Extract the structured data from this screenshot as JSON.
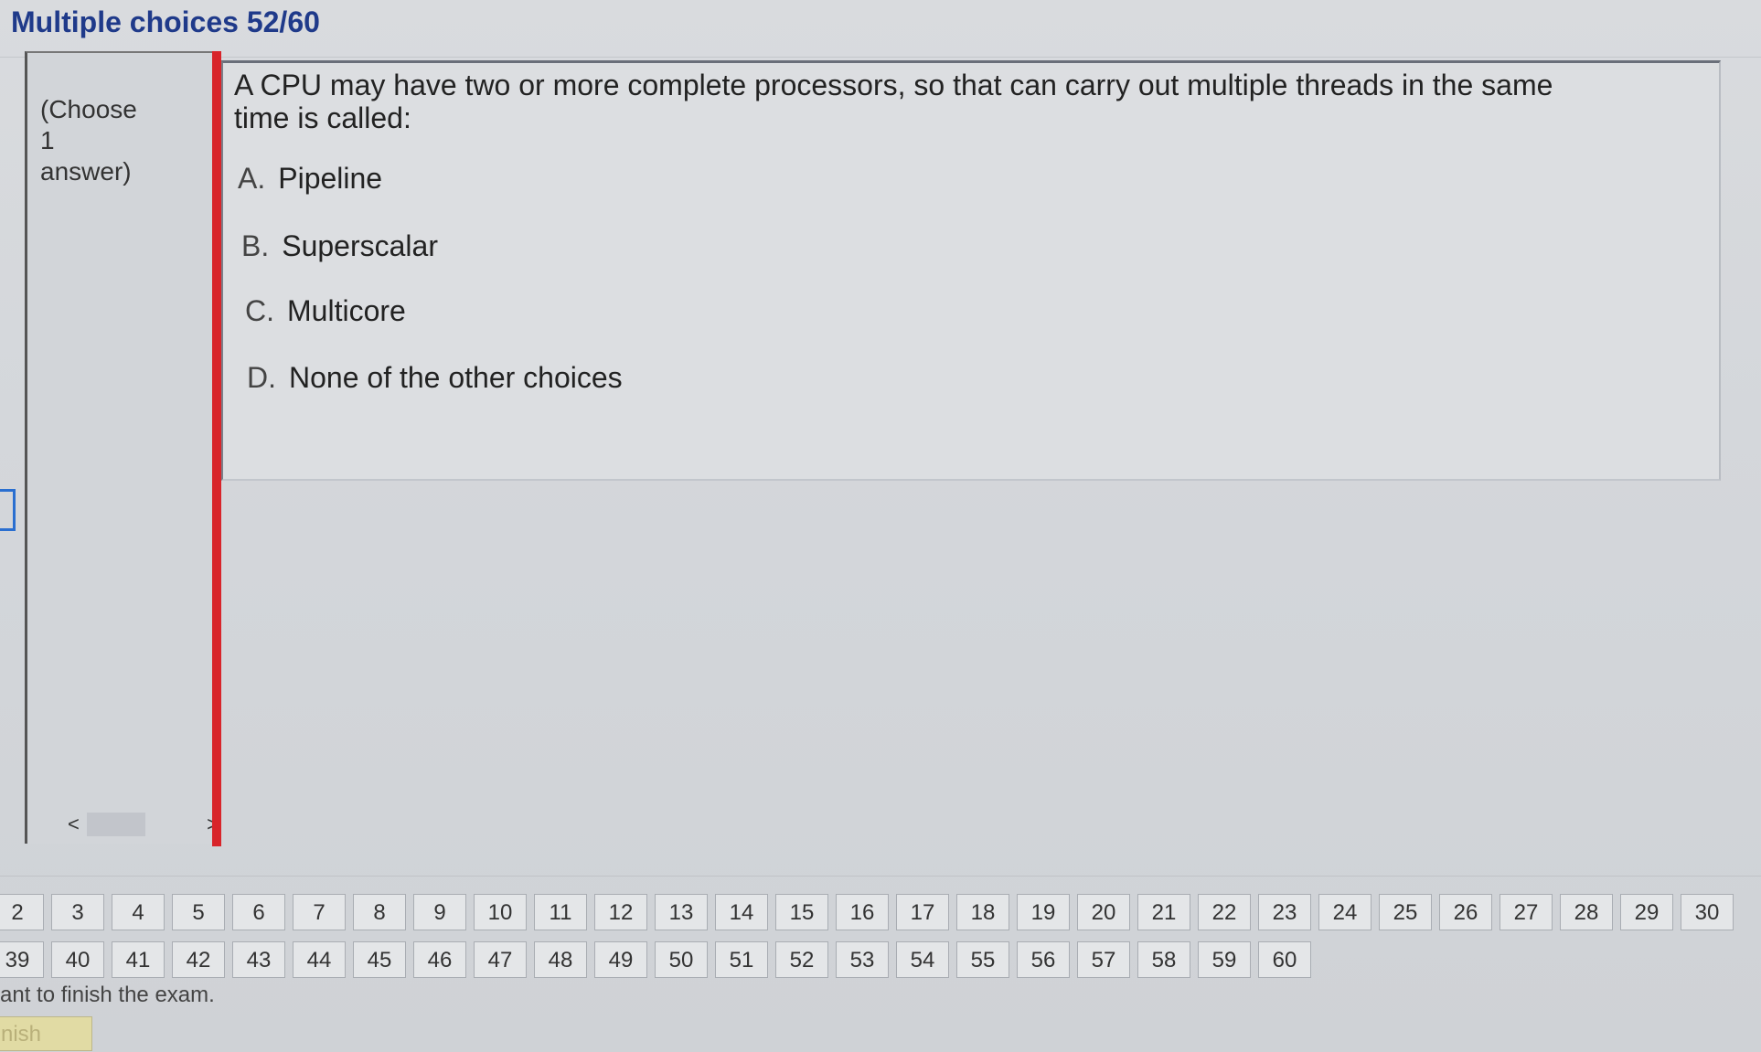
{
  "header": {
    "title": "Multiple choices 52/60"
  },
  "side": {
    "instruction": "(Choose\n1\nanswer)",
    "scroll_left": "<",
    "scroll_right": ">"
  },
  "question": {
    "text": "A CPU may have  two or more complete processors, so that can carry out multiple threads in the same time is called:",
    "options": [
      {
        "letter": "A.",
        "text": "Pipeline"
      },
      {
        "letter": "B.",
        "text": "Superscalar"
      },
      {
        "letter": "C.",
        "text": "Multicore"
      },
      {
        "letter": "D.",
        "text": "None of  the other choices"
      }
    ]
  },
  "navigator": {
    "row1": [
      "2",
      "3",
      "4",
      "5",
      "6",
      "7",
      "8",
      "9",
      "10",
      "11",
      "12",
      "13",
      "14",
      "15",
      "16",
      "17",
      "18",
      "19",
      "20",
      "21",
      "22",
      "23",
      "24",
      "25",
      "26",
      "27",
      "28",
      "29",
      "30"
    ],
    "row2": [
      "39",
      "40",
      "41",
      "42",
      "43",
      "44",
      "45",
      "46",
      "47",
      "48",
      "49",
      "50",
      "51",
      "52",
      "53",
      "54",
      "55",
      "56",
      "57",
      "58",
      "59",
      "60"
    ]
  },
  "footer": {
    "note": "ant to finish the exam.",
    "finish_label": "nish"
  }
}
